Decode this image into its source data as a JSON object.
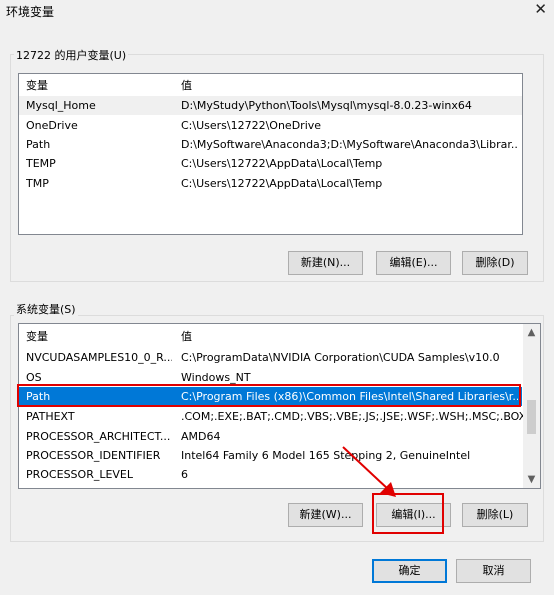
{
  "window": {
    "title": "环境变量",
    "close_glyph": "✕"
  },
  "user_vars": {
    "group_label": "12722 的用户变量(U)",
    "headers": [
      "变量",
      "值"
    ],
    "rows": [
      [
        "Mysql_Home",
        "D:\\MyStudy\\Python\\Tools\\Mysql\\mysql-8.0.23-winx64"
      ],
      [
        "OneDrive",
        "C:\\Users\\12722\\OneDrive"
      ],
      [
        "Path",
        "D:\\MySoftware\\Anaconda3;D:\\MySoftware\\Anaconda3\\Librar..."
      ],
      [
        "TEMP",
        "C:\\Users\\12722\\AppData\\Local\\Temp"
      ],
      [
        "TMP",
        "C:\\Users\\12722\\AppData\\Local\\Temp"
      ]
    ],
    "buttons": {
      "new": "新建(N)...",
      "edit": "编辑(E)...",
      "delete": "删除(D)"
    }
  },
  "system_vars": {
    "group_label": "系统变量(S)",
    "headers": [
      "变量",
      "值"
    ],
    "rows": [
      [
        "NVCUDASAMPLES10_0_R...",
        "C:\\ProgramData\\NVIDIA Corporation\\CUDA Samples\\v10.0"
      ],
      [
        "OS",
        "Windows_NT"
      ],
      [
        "Path",
        "C:\\Program Files (x86)\\Common Files\\Intel\\Shared Libraries\\r..."
      ],
      [
        "PATHEXT",
        ".COM;.EXE;.BAT;.CMD;.VBS;.VBE;.JS;.JSE;.WSF;.WSH;.MSC;.BOX"
      ],
      [
        "PROCESSOR_ARCHITECT...",
        "AMD64"
      ],
      [
        "PROCESSOR_IDENTIFIER",
        "Intel64 Family 6 Model 165 Stepping 2, GenuineIntel"
      ],
      [
        "PROCESSOR_LEVEL",
        "6"
      ]
    ],
    "selected_row": "Path",
    "buttons": {
      "new": "新建(W)...",
      "edit": "编辑(I)...",
      "delete": "删除(L)"
    }
  },
  "dialog_buttons": {
    "ok": "确定",
    "cancel": "取消"
  },
  "colors": {
    "selection": "#0078d7",
    "annotation": "#e00000"
  }
}
